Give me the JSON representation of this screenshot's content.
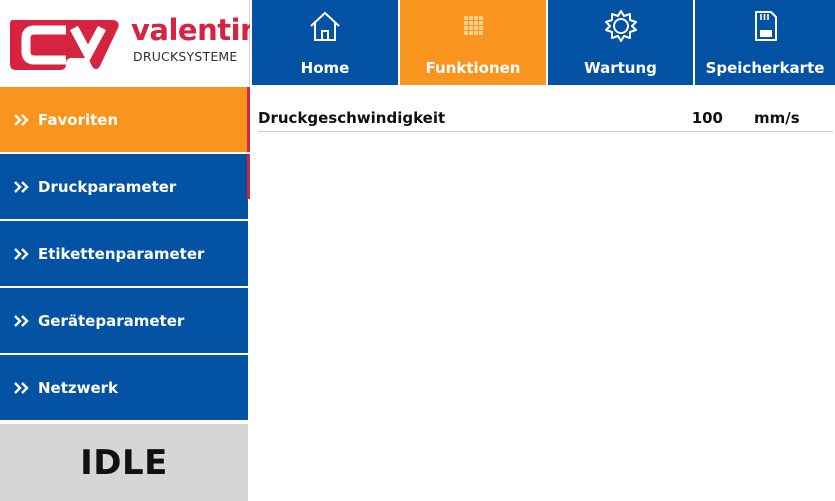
{
  "brand": {
    "name": "valentin",
    "subtitle": "DRUCKSYSTEME",
    "color": "#d6233f"
  },
  "top_nav": [
    {
      "label": "Home",
      "icon": "home-icon",
      "active": false
    },
    {
      "label": "Funktionen",
      "icon": "grid-icon",
      "active": true
    },
    {
      "label": "Wartung",
      "icon": "gear-icon",
      "active": false
    },
    {
      "label": "Speicherkarte",
      "icon": "sd-card-icon",
      "active": false
    }
  ],
  "side_nav": [
    {
      "label": "Favoriten",
      "active": true
    },
    {
      "label": "Druckparameter",
      "active": false
    },
    {
      "label": "Etikettenparameter",
      "active": false
    },
    {
      "label": "Geräteparameter",
      "active": false
    },
    {
      "label": "Netzwerk",
      "active": false
    }
  ],
  "status": "IDLE",
  "parameters": [
    {
      "name": "Druckgeschwindigkeit",
      "value": "100",
      "unit": "mm/s"
    }
  ],
  "colors": {
    "nav_blue": "#0452a3",
    "active_orange": "#f9941e",
    "status_gray": "#d6d6d6"
  }
}
